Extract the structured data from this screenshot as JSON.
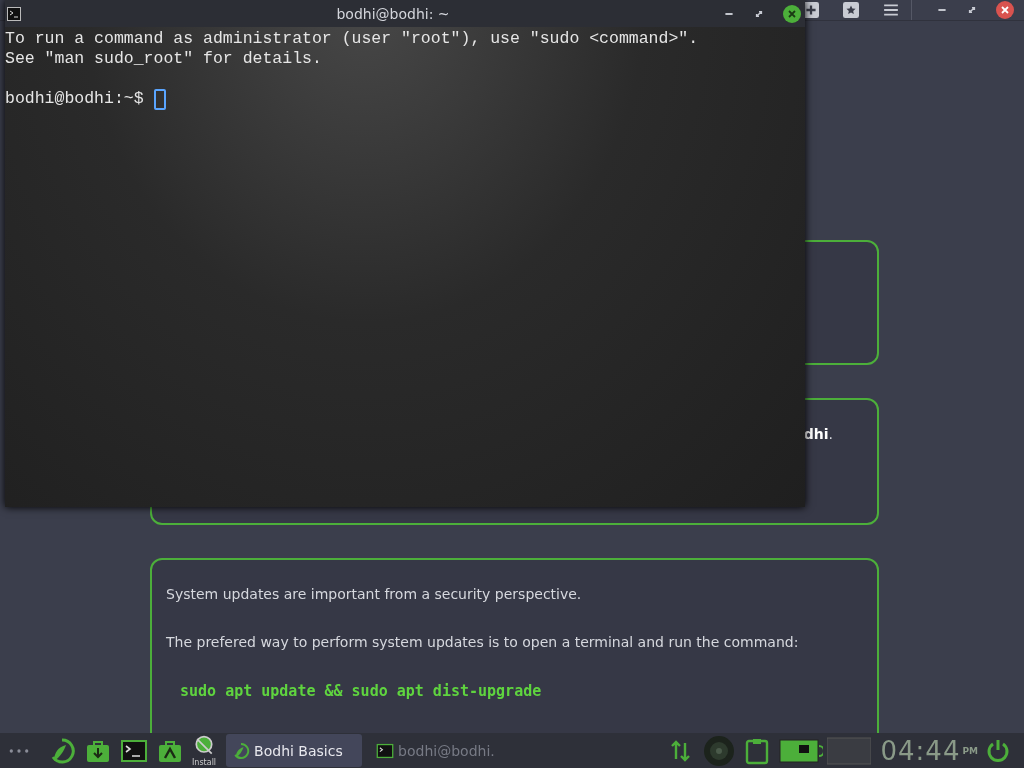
{
  "terminal": {
    "title": "bodhi@bodhi: ~",
    "lines": [
      "To run a command as administrator (user \"root\"), use \"sudo <command>\".",
      "See \"man sudo_root\" for details."
    ],
    "prompt": "bodhi@bodhi:~$ "
  },
  "cards": [
    {
      "paragraphs": [
        {
          "kind": "text",
          "text": "**dhi**."
        }
      ]
    },
    {
      "paragraphs": [
        {
          "kind": "text",
          "text": "System updates are important from a security perspective."
        },
        {
          "kind": "text",
          "text": "The prefered way to perform system updates is to open a terminal and run the command:"
        },
        {
          "kind": "code",
          "text": "sudo apt update && sudo apt dist-upgrade"
        }
      ]
    }
  ],
  "taskbar": {
    "install_label": "Install",
    "tasks": [
      {
        "label": "Bodhi Basics",
        "selected": true
      },
      {
        "label": "bodhi@bodhi.",
        "selected": false
      }
    ],
    "clock": {
      "time": "04:44",
      "ampm": "PM"
    }
  }
}
